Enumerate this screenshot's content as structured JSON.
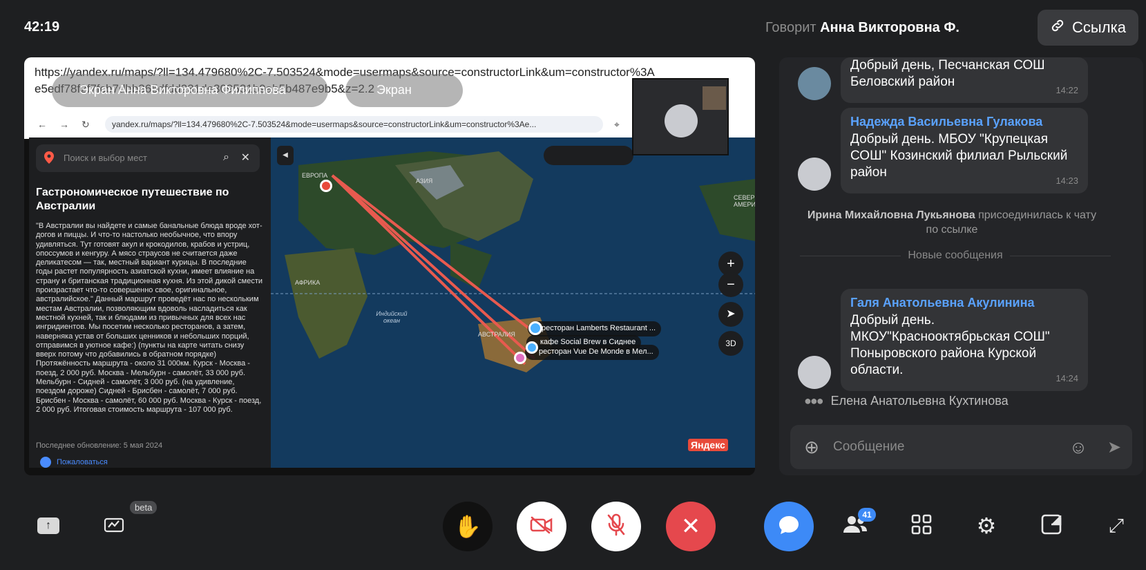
{
  "header": {
    "timer": "42:19",
    "speaking_label": "Говорит",
    "speaking_name": "Анна Викторовна Ф.",
    "link_label": "Ссылка"
  },
  "share": {
    "url_overlay": "https://yandex.ru/maps/?ll=134.479680%2C-7.503524&mode=usermaps&source=constructorLink&um=constructor%3Ae5edf78f2f7fcb7dbb365dfdd231de309531b9ab5b487e9b5&z=2.2",
    "presenter_chip": "Экран Анна Викторовна Филиппова",
    "screen_chip": "Экран",
    "browser_url": "yandex.ru/maps/?ll=134.479680%2C-7.503524&mode=usermaps&source=constructorLink&um=constructor%3Ae...",
    "map_search_placeholder": "Поиск и выбор мест",
    "map_title": "Гастрономическое путешествие по Австралии",
    "map_description": "\"В Австралии вы найдете и самые банальные блюда вроде хот-догов и пиццы. И что-то настолько необычное, что впору удивляться. Тут готовят акул и крокодилов, крабов и устриц, опоссумов и кенгуру. А мясо страусов не считается даже деликатесом — так, местный вариант курицы. В последние годы растет популярность азиатской кухни, имеет влияние на страну и британская традиционная кухня. Из этой дикой смести произрастает что-то совершенно свое, оригинальное, австралийское.\" Данный маршрут проведёт нас по нескольким местам Австралии, позволяющим вдоволь насладиться как местной кухней, так и блюдами из привычных для всех нас ингридиентов. Мы посетим несколько ресторанов, а затем, наверняка устав от больших ценников и небольших порций, отправимся в уютное кафе:) (пункты на карте читать снизу вверх потому что добавились в обратном порядке) Протяжённость маршрута - около 31 000км. Курск - Москва - поезд, 2 000 руб. Москва - Мельбурн - самолёт, 33 000 руб. Мельбурн - Сидней - самолёт, 3 000 руб. (на удивление, поездом дороже) Сидней - Брисбен - самолёт, 7 000 руб. Брисбен - Москва - самолёт, 60 000 руб. Москва - Курск - поезд, 2 000 руб. Итоговая стоимость маршрута - 107 000 руб.",
    "updated": "Последнее обновление: 5 мая 2024",
    "complain": "Пожаловаться",
    "map_labels": {
      "europe": "ЕВРОПА",
      "asia": "АЗИЯ",
      "africa": "АФРИКА",
      "indian_ocean": "Индийский океан",
      "australia": "АВСТРАЛИЯ",
      "north_america": "СЕВЕР АМЕРИ",
      "pin1": "ресторан Lamberts Restaurant ...",
      "pin2": "кафе Social Brew в Сиднее",
      "pin3": "ресторан Vue De Monde в Мел...",
      "btn_3d": "3D",
      "logo": "Яндекс"
    }
  },
  "chat": {
    "messages": [
      {
        "text": "Добрый день, Песчанская СОШ Беловский район",
        "time": "14:22"
      },
      {
        "author": "Надежда Васильевна Гулакова",
        "text": "Добрый день. МБОУ \"Крупецкая СОШ\" Козинский филиал Рыльский район",
        "time": "14:23"
      },
      {
        "author": "Галя Анатольевна Акулинина",
        "text": "Добрый день. МКОУ\"Краснооктябрьская СОШ\" Поныровского района Курской области.",
        "time": "14:24"
      }
    ],
    "join_name": "Ирина Михайловна Лукьянова",
    "join_text": "присоединилась к чату по ссылке",
    "new_messages": "Новые сообщения",
    "typing_name": "Елена Анатольевна Кухтинова",
    "composer_placeholder": "Сообщение"
  },
  "controls": {
    "beta": "beta",
    "participants_count": "41",
    "colors": {
      "end_call": "#e5484d",
      "chat_active": "#3d8af7",
      "white_btn": "#ffffff"
    }
  }
}
